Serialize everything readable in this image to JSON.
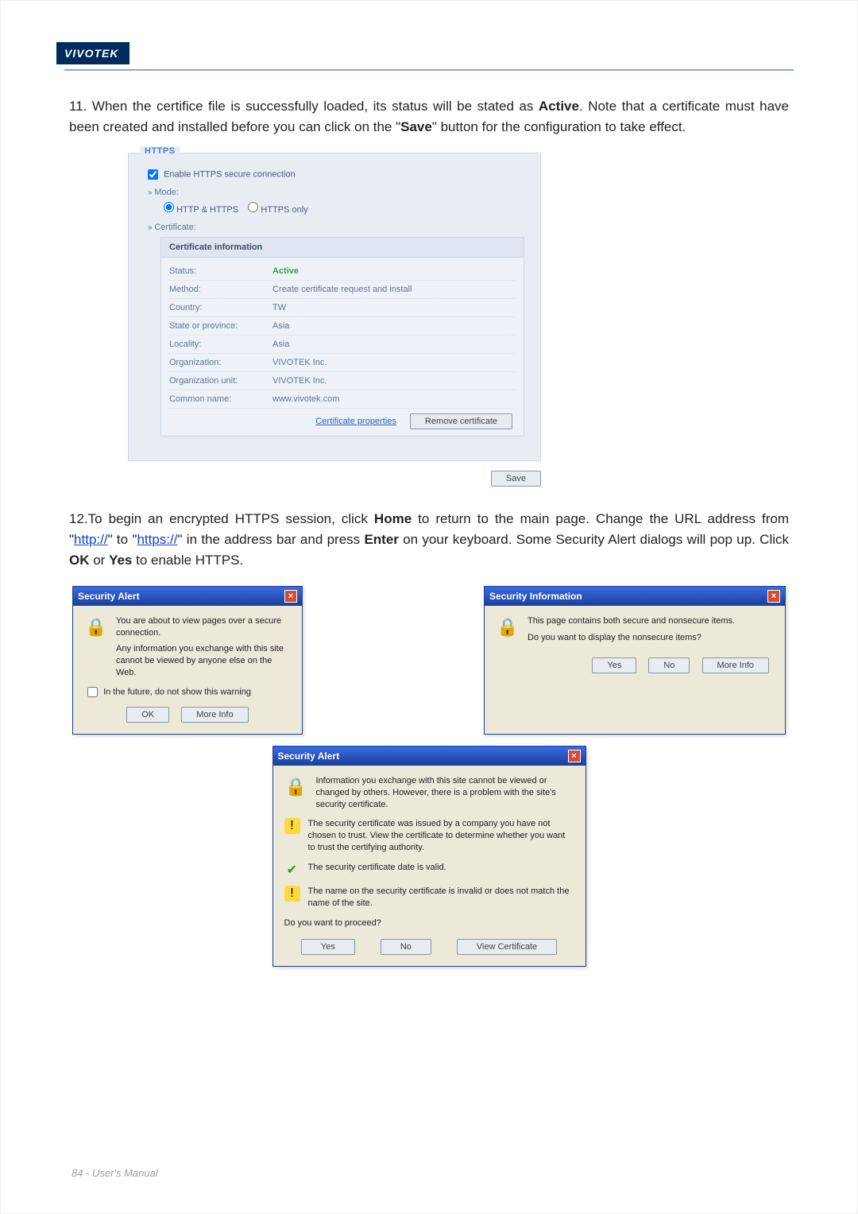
{
  "brand": "VIVOTEK",
  "para11": {
    "prefix": "11. When the certifice file is successfully loaded, its status will be stated as ",
    "active": "Active",
    "middle": ". Note that a certificate must have been created and installed before you can click on the \"",
    "save": "Save",
    "suffix": "\" button for the configuration to take effect."
  },
  "httpsPanel": {
    "legend": "HTTPS",
    "enableLabel": "Enable HTTPS secure connection",
    "modeLabel": "Mode:",
    "radio1": "HTTP & HTTPS",
    "radio2": "HTTPS only",
    "certSection": "Certificate:",
    "certHeader": "Certificate information",
    "rows": [
      {
        "k": "Status:",
        "v": "Active",
        "active": true
      },
      {
        "k": "Method:",
        "v": "Create certificate request and install"
      },
      {
        "k": "Country:",
        "v": "TW"
      },
      {
        "k": "State or province:",
        "v": "Asia"
      },
      {
        "k": "Locality:",
        "v": "Asia"
      },
      {
        "k": "Organization:",
        "v": "VIVOTEK Inc."
      },
      {
        "k": "Organization unit:",
        "v": "VIVOTEK Inc."
      },
      {
        "k": "Common name:",
        "v": "www.vivotek.com"
      }
    ],
    "certProps": "Certificate properties",
    "removeCert": "Remove certificate",
    "saveBtn": "Save"
  },
  "para12": {
    "prefix": "12.To begin an encrypted HTTPS session, click ",
    "home": "Home",
    "mid1": " to return to the main page. Change the URL address from \"",
    "http": "http://",
    "mid2": "\" to \"",
    "https": "https://",
    "mid3": "\" in the address bar and press ",
    "enter": "Enter",
    "mid4": " on your keyboard. Some Security Alert dialogs will pop up. Click ",
    "ok": "OK",
    "or": " or ",
    "yes": "Yes",
    "suffix": " to enable HTTPS."
  },
  "dlg1": {
    "title": "Security Alert",
    "msg1": "You are about to view pages over a secure connection.",
    "msg2": "Any information you exchange with this site cannot be viewed by anyone else on the Web.",
    "cbLabel": "In the future, do not show this warning",
    "ok": "OK",
    "more": "More Info"
  },
  "dlg2": {
    "title": "Security Information",
    "msg1": "This page contains both secure and nonsecure items.",
    "msg2": "Do you want to display the nonsecure items?",
    "yes": "Yes",
    "no": "No",
    "more": "More Info"
  },
  "dlg3": {
    "title": "Security Alert",
    "intro": "Information you exchange with this site cannot be viewed or changed by others. However, there is a problem with the site's security certificate.",
    "warn1": "The security certificate was issued by a company you have not chosen to trust. View the certificate to determine whether you want to trust the certifying authority.",
    "ok1": "The security certificate date is valid.",
    "warn2": "The name on the security certificate is invalid or does not match the name of the site.",
    "proceed": "Do you want to proceed?",
    "yes": "Yes",
    "no": "No",
    "view": "View Certificate"
  },
  "footer": "84 - User's Manual"
}
